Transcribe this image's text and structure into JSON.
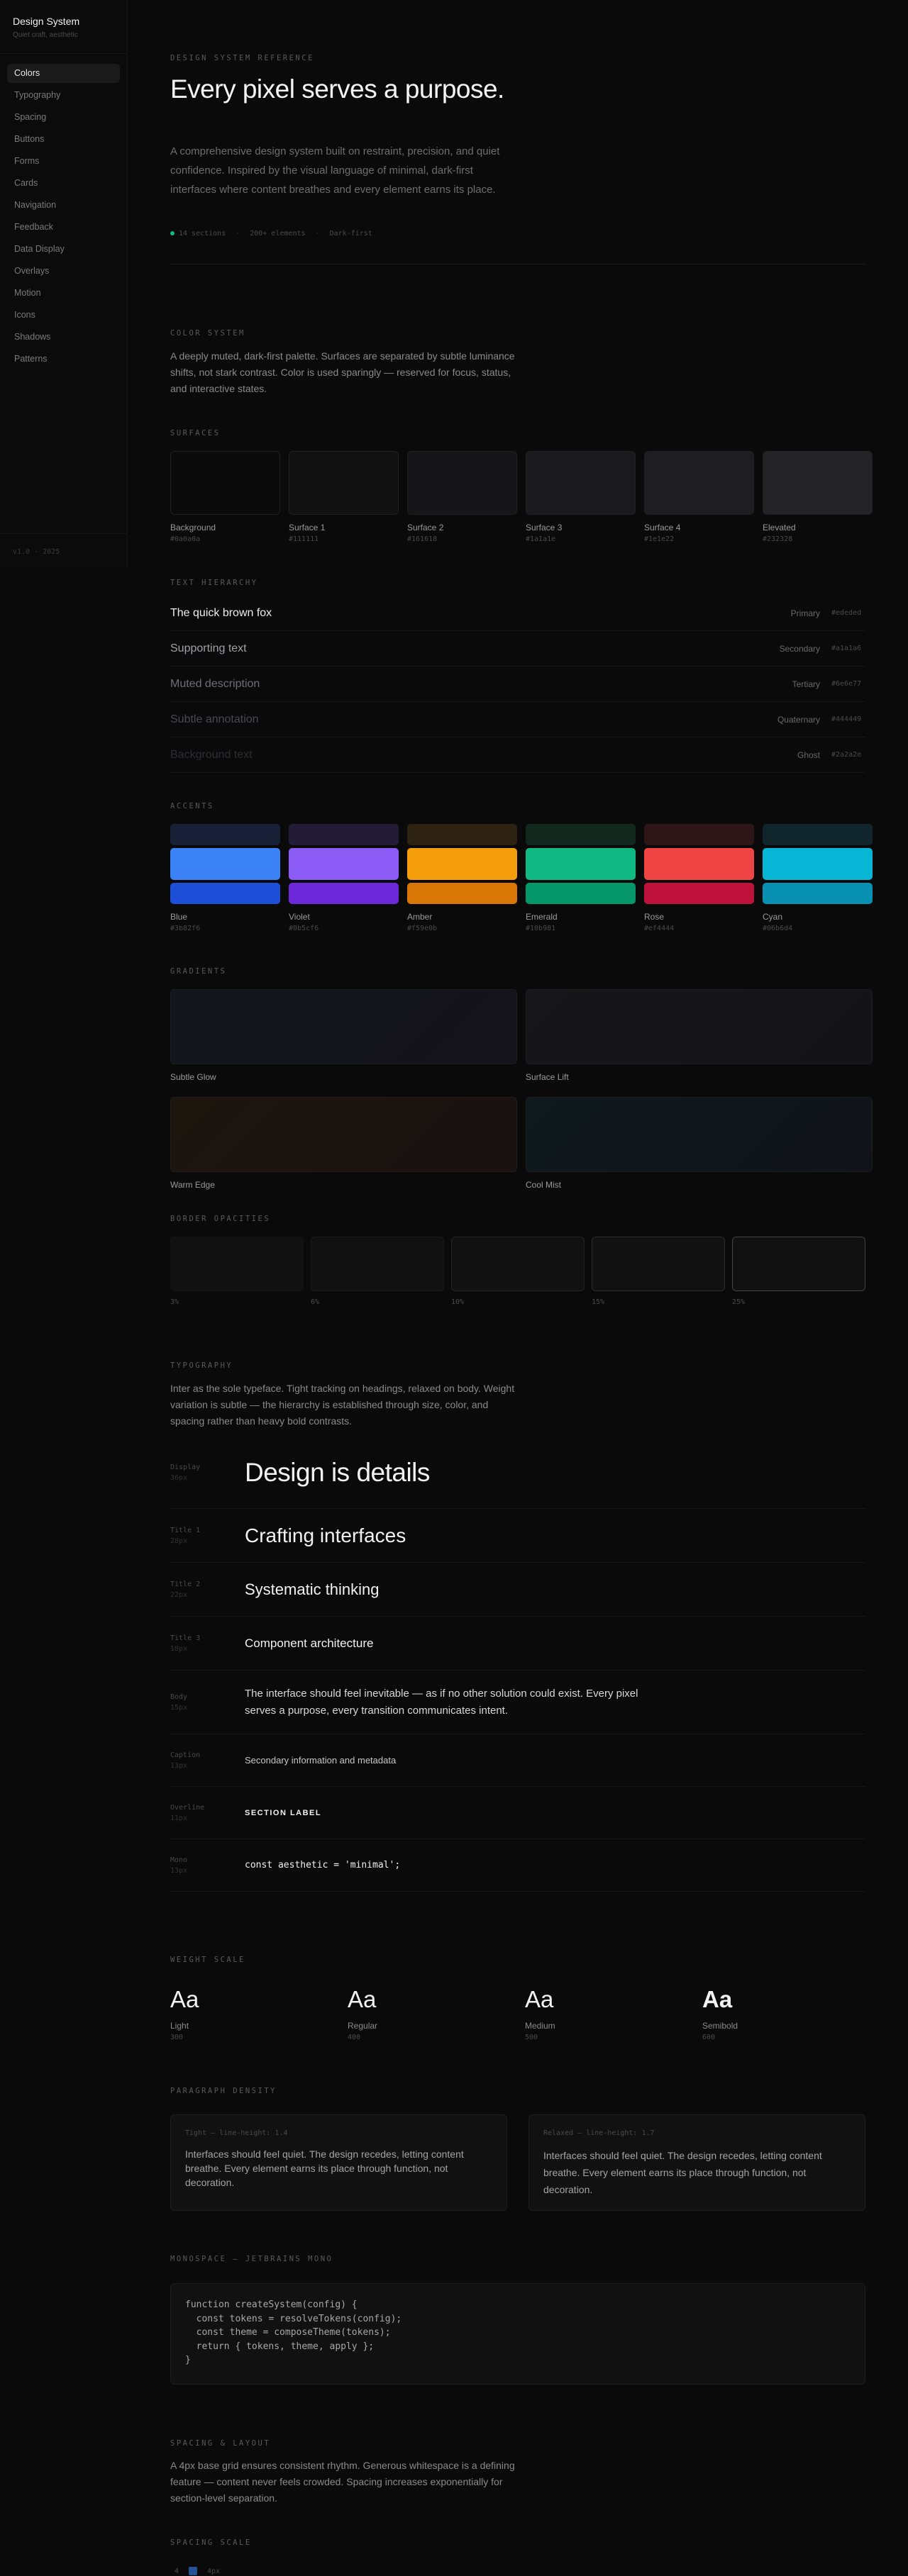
{
  "sidebar": {
    "title": "Design System",
    "subtitle": "Quiet craft, aesthetic",
    "items": [
      "Colors",
      "Typography",
      "Spacing",
      "Buttons",
      "Forms",
      "Cards",
      "Navigation",
      "Feedback",
      "Data Display",
      "Overlays",
      "Motion",
      "Icons",
      "Shadows",
      "Patterns"
    ],
    "active": "Colors",
    "footer": "v1.0 · 2025"
  },
  "hero": {
    "eyebrow": "DESIGN SYSTEM REFERENCE",
    "title": "Every pixel serves a purpose.",
    "description": "A comprehensive design system built on restraint, precision, and quiet confidence. Inspired by the visual language of minimal, dark-first interfaces where content breathes and every element earns its place.",
    "meta": [
      "14 sections",
      "200+ elements",
      "Dark-first"
    ]
  },
  "colors": {
    "label": "COLOR SYSTEM",
    "intro": "A deeply muted, dark-first palette. Surfaces are separated by subtle luminance shifts, not stark contrast. Color is used sparingly — reserved for focus, status, and interactive states.",
    "surfaces_label": "SURFACES",
    "surfaces": [
      {
        "name": "Background",
        "hex": "#0a0a0a"
      },
      {
        "name": "Surface 1",
        "hex": "#111111"
      },
      {
        "name": "Surface 2",
        "hex": "#161618"
      },
      {
        "name": "Surface 3",
        "hex": "#1a1a1e"
      },
      {
        "name": "Surface 4",
        "hex": "#1e1e22"
      },
      {
        "name": "Elevated",
        "hex": "#232328"
      }
    ],
    "text_label": "TEXT HIERARCHY",
    "text_rows": [
      {
        "sample": "The quick brown fox",
        "name": "Primary",
        "hex": "#ededed",
        "color": "#ededed"
      },
      {
        "sample": "Supporting text",
        "name": "Secondary",
        "hex": "#a1a1a6",
        "color": "#a1a1a6"
      },
      {
        "sample": "Muted description",
        "name": "Tertiary",
        "hex": "#6e6e77",
        "color": "#6e6e77"
      },
      {
        "sample": "Subtle annotation",
        "name": "Quaternary",
        "hex": "#444449",
        "color": "#4a4a4f"
      },
      {
        "sample": "Background text",
        "name": "Ghost",
        "hex": "#2a2a2e",
        "color": "#2e2e32"
      }
    ],
    "accents_label": "ACCENTS",
    "accents": [
      {
        "name": "Blue",
        "hex": "#3b82f6",
        "muted": "#172036",
        "dark": "#1d4ed8"
      },
      {
        "name": "Violet",
        "hex": "#8b5cf6",
        "muted": "#231c37",
        "dark": "#6d28d9"
      },
      {
        "name": "Amber",
        "hex": "#f59e0b",
        "muted": "#2e2212",
        "dark": "#d97706"
      },
      {
        "name": "Emerald",
        "hex": "#10b981",
        "muted": "#12281f",
        "dark": "#059669"
      },
      {
        "name": "Rose",
        "hex": "#ef4444",
        "muted": "#2e1618",
        "dark": "#be123c"
      },
      {
        "name": "Cyan",
        "hex": "#06b6d4",
        "muted": "#10262c",
        "dark": "#0891b2"
      }
    ],
    "gradients_label": "GRADIENTS",
    "gradients": [
      {
        "name": "Subtle Glow",
        "from": "#13141c",
        "to": "#15131c"
      },
      {
        "name": "Surface Lift",
        "from": "#17171a",
        "to": "#141416"
      },
      {
        "name": "Warm Edge",
        "from": "#1c160f",
        "to": "#1a1111"
      },
      {
        "name": "Cool Mist",
        "from": "#0f1a1c",
        "to": "#111318"
      }
    ],
    "borders_label": "BORDER OPACITIES",
    "borders": [
      {
        "name": "3%",
        "color": "#141414"
      },
      {
        "name": "6%",
        "color": "#1b1b1b"
      },
      {
        "name": "10%",
        "color": "#242424"
      },
      {
        "name": "15%",
        "color": "#2e2e2e"
      },
      {
        "name": "25%",
        "color": "#444444"
      }
    ]
  },
  "typography": {
    "label": "TYPOGRAPHY",
    "intro": "Inter as the sole typeface. Tight tracking on headings, relaxed on body. Weight variation is subtle — the hierarchy is established through size, color, and spacing rather than heavy bold contrasts.",
    "scale": [
      {
        "name": "Display",
        "size": "36px",
        "sample": "Design is details"
      },
      {
        "name": "Title 1",
        "size": "28px",
        "sample": "Crafting interfaces"
      },
      {
        "name": "Title 2",
        "size": "22px",
        "sample": "Systematic thinking"
      },
      {
        "name": "Title 3",
        "size": "18px",
        "sample": "Component architecture"
      },
      {
        "name": "Body",
        "size": "15px",
        "sample": "The interface should feel inevitable — as if no other solution could exist. Every pixel serves a purpose, every transition communicates intent."
      },
      {
        "name": "Caption",
        "size": "13px",
        "sample": "Secondary information and metadata"
      },
      {
        "name": "Overline",
        "size": "11px",
        "sample": "SECTION LABEL"
      },
      {
        "name": "Mono",
        "size": "13px",
        "sample": "const aesthetic = 'minimal';"
      }
    ],
    "weight_label": "WEIGHT SCALE",
    "weights": [
      {
        "glyph": "Aa",
        "name": "Light",
        "value": "300"
      },
      {
        "glyph": "Aa",
        "name": "Regular",
        "value": "400"
      },
      {
        "glyph": "Aa",
        "name": "Medium",
        "value": "500"
      },
      {
        "glyph": "Aa",
        "name": "Semibold",
        "value": "600"
      }
    ],
    "paragraph_label": "PARAGRAPH DENSITY",
    "paragraphs": [
      {
        "label": "Tight — line-height: 1.4",
        "text": "Interfaces should feel quiet. The design recedes, letting content breathe. Every element earns its place through function, not decoration."
      },
      {
        "label": "Relaxed — line-height: 1.7",
        "text": "Interfaces should feel quiet. The design recedes, letting content breathe. Every element earns its place through function, not decoration."
      }
    ],
    "mono_label": "MONOSPACE — JETBRAINS MONO",
    "code": [
      "function createSystem(config) {",
      "  const tokens = resolveTokens(config);",
      "  const theme = composeTheme(tokens);",
      "  return { tokens, theme, apply };",
      "}"
    ]
  },
  "spacing": {
    "label": "SPACING & LAYOUT",
    "intro": "A 4px base grid ensures consistent rhythm. Generous whitespace is a defining feature — content never feels crowded. Spacing increases exponentially for section-level separation.",
    "scale_label": "SPACING SCALE",
    "first": {
      "n": "4",
      "v": "4px"
    }
  }
}
